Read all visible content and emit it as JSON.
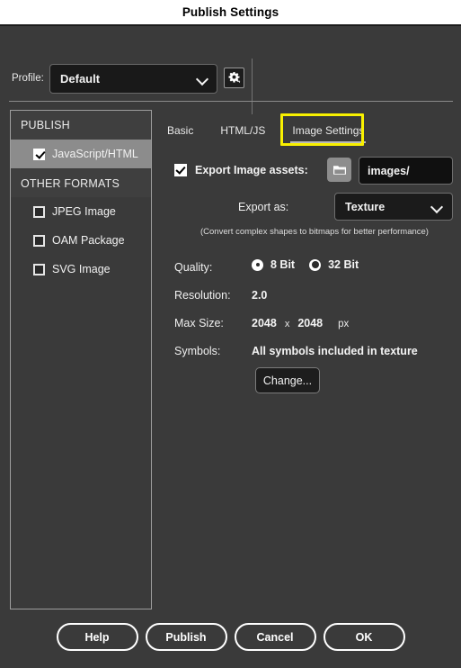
{
  "window": {
    "title": "Publish Settings"
  },
  "profile": {
    "label": "Profile:",
    "value": "Default",
    "gear_icon": "gear-icon",
    "chevron_icon": "chevron-down-icon"
  },
  "sidebar": {
    "groups": [
      {
        "header": "PUBLISH",
        "items": [
          {
            "label": "JavaScript/HTML",
            "checked": true,
            "selected": true
          }
        ]
      },
      {
        "header": "OTHER FORMATS",
        "items": [
          {
            "label": "JPEG Image",
            "checked": false,
            "selected": false
          },
          {
            "label": "OAM Package",
            "checked": false,
            "selected": false
          },
          {
            "label": "SVG Image",
            "checked": false,
            "selected": false
          }
        ]
      }
    ]
  },
  "panel": {
    "tabs": [
      {
        "label": "Basic",
        "active": false
      },
      {
        "label": "HTML/JS",
        "active": false
      },
      {
        "label": "Image Settings",
        "active": true,
        "highlighted": true
      }
    ],
    "highlight_color": "#f8f000",
    "export_assets": {
      "label": "Export Image assets:",
      "checked": true,
      "folder_icon": "folder-icon",
      "path_value": "images/"
    },
    "export_as": {
      "label": "Export as:",
      "value": "Texture",
      "chevron_icon": "chevron-down-icon"
    },
    "hint": "(Convert complex shapes to bitmaps for better performance)",
    "quality": {
      "label": "Quality:",
      "options": [
        {
          "label": "8 Bit",
          "selected": true
        },
        {
          "label": "32 Bit",
          "selected": false
        }
      ]
    },
    "resolution": {
      "label": "Resolution:",
      "value": "2.0"
    },
    "max_size": {
      "label": "Max Size:",
      "width": "2048",
      "separator": "x",
      "height": "2048",
      "unit": "px"
    },
    "symbols": {
      "label": "Symbols:",
      "value": "All symbols included in texture",
      "change_button": "Change..."
    }
  },
  "footer": {
    "buttons": [
      {
        "label": "Help"
      },
      {
        "label": "Publish"
      },
      {
        "label": "Cancel"
      },
      {
        "label": "OK"
      }
    ]
  }
}
